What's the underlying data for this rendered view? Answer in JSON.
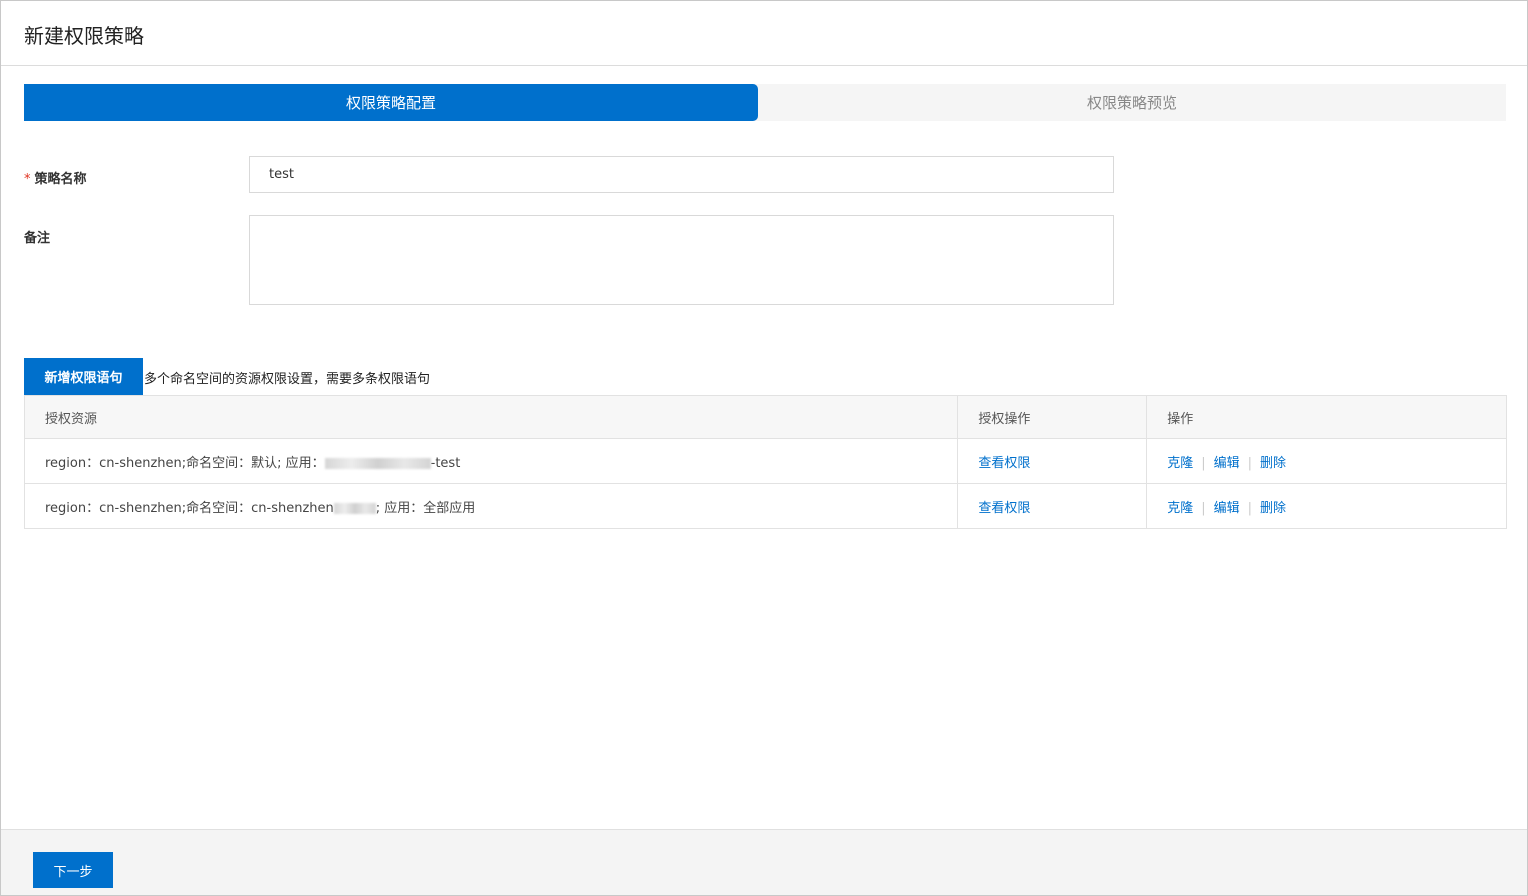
{
  "page": {
    "title": "新建权限策略"
  },
  "steps": [
    {
      "label": "权限策略配置",
      "active": true
    },
    {
      "label": "权限策略预览",
      "active": false
    }
  ],
  "form": {
    "name_label": "策略名称",
    "name_required_mark": "*",
    "name_value": "test",
    "remark_label": "备注",
    "remark_value": ""
  },
  "statements": {
    "add_button_label": "新增权限语句",
    "hint": "多个命名空间的资源权限设置，需要多条权限语句",
    "columns": [
      "授权资源",
      "授权操作",
      "操作"
    ],
    "rows": [
      {
        "resource_prefix": "region：cn-shenzhen;命名空间：默认; 应用：",
        "resource_suffix": "-test",
        "auth_action": "查看权限",
        "ops": [
          "克隆",
          "编辑",
          "删除"
        ]
      },
      {
        "resource_prefix": "region：cn-shenzhen;命名空间：cn-shenzhen",
        "resource_suffix": "; 应用：全部应用",
        "auth_action": "查看权限",
        "ops": [
          "克隆",
          "编辑",
          "删除"
        ]
      }
    ]
  },
  "footer": {
    "next_label": "下一步"
  },
  "colors": {
    "primary": "#0070cc",
    "required": "#e0301e"
  }
}
